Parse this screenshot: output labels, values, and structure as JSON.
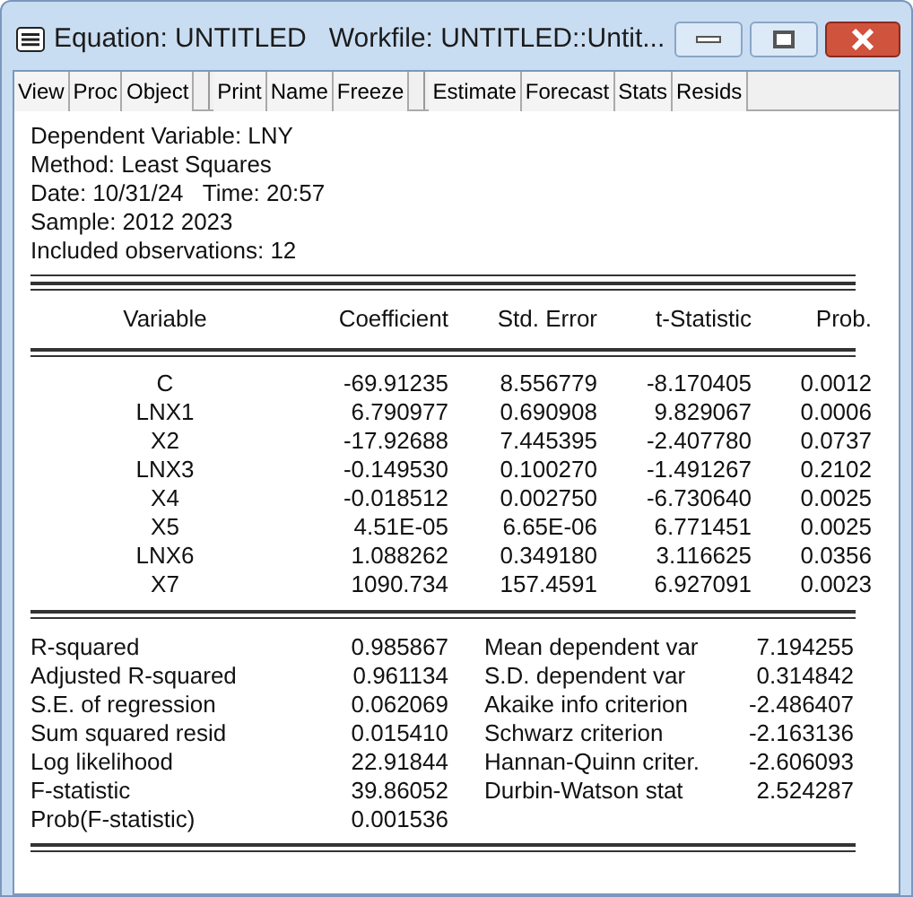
{
  "window": {
    "title": "Equation: UNTITLED   Workfile: UNTITLED::Untit..."
  },
  "toolbar_groups": [
    [
      "View",
      "Proc",
      "Object"
    ],
    [
      "Print",
      "Name",
      "Freeze"
    ],
    [
      "Estimate",
      "Forecast",
      "Stats",
      "Resids"
    ]
  ],
  "header_lines": [
    "Dependent Variable: LNY",
    "Method: Least Squares",
    "Date: 10/31/24   Time: 20:57",
    "Sample: 2012 2023",
    "Included observations: 12"
  ],
  "table": {
    "columns": [
      "Variable",
      "Coefficient",
      "Std. Error",
      "t-Statistic",
      "Prob."
    ],
    "rows": [
      [
        "C",
        "-69.91235",
        "8.556779",
        "-8.170405",
        "0.0012"
      ],
      [
        "LNX1",
        "6.790977",
        "0.690908",
        "9.829067",
        "0.0006"
      ],
      [
        "X2",
        "-17.92688",
        "7.445395",
        "-2.407780",
        "0.0737"
      ],
      [
        "LNX3",
        "-0.149530",
        "0.100270",
        "-1.491267",
        "0.2102"
      ],
      [
        "X4",
        "-0.018512",
        "0.002750",
        "-6.730640",
        "0.0025"
      ],
      [
        "X5",
        "4.51E-05",
        "6.65E-06",
        "6.771451",
        "0.0025"
      ],
      [
        "LNX6",
        "1.088262",
        "0.349180",
        "3.116625",
        "0.0356"
      ],
      [
        "X7",
        "1090.734",
        "157.4591",
        "6.927091",
        "0.0023"
      ]
    ]
  },
  "statistics": [
    [
      "R-squared",
      "0.985867",
      "Mean dependent var",
      "7.194255"
    ],
    [
      "Adjusted R-squared",
      "0.961134",
      "S.D. dependent var",
      "0.314842"
    ],
    [
      "S.E. of regression",
      "0.062069",
      "Akaike info criterion",
      "-2.486407"
    ],
    [
      "Sum squared resid",
      "0.015410",
      "Schwarz criterion",
      "-2.163136"
    ],
    [
      "Log likelihood",
      "22.91844",
      "Hannan-Quinn criter.",
      "-2.606093"
    ],
    [
      "F-statistic",
      "39.86052",
      "Durbin-Watson stat",
      "2.524287"
    ],
    [
      "Prob(F-statistic)",
      "0.001536"
    ]
  ]
}
